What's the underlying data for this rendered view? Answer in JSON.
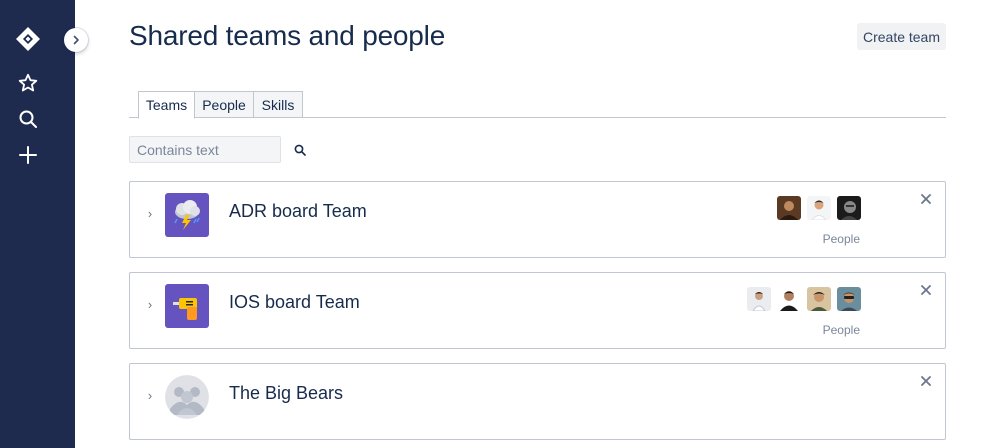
{
  "app": {
    "title": "Shared teams and people"
  },
  "sidebar": {
    "logo_icon": "jira-diamond-logo",
    "items": [
      {
        "name": "starred",
        "icon": "star-icon"
      },
      {
        "name": "search",
        "icon": "search-icon"
      },
      {
        "name": "create",
        "icon": "plus-icon"
      }
    ],
    "collapse_icon": "chevron-right-icon"
  },
  "header": {
    "title": "Shared teams and people",
    "create_label": "Create team"
  },
  "tabs": [
    {
      "label": "Teams",
      "active": true
    },
    {
      "label": "People",
      "active": false
    },
    {
      "label": "Skills",
      "active": false
    }
  ],
  "filter": {
    "placeholder": "Contains text",
    "value": ""
  },
  "teams": [
    {
      "name": "ADR board Team",
      "avatar": "storm-cloud",
      "people_label": "People",
      "member_count": 3
    },
    {
      "name": "IOS board Team",
      "avatar": "drill",
      "people_label": "People",
      "member_count": 4
    },
    {
      "name": "The Big Bears",
      "avatar": "default-group",
      "people_label": "",
      "member_count": 0
    }
  ],
  "colors": {
    "sidebar_bg": "#1e2b4f",
    "team_avatar_purple": "#6554c0",
    "text_primary": "#172b4d",
    "text_muted": "#7a869a"
  }
}
